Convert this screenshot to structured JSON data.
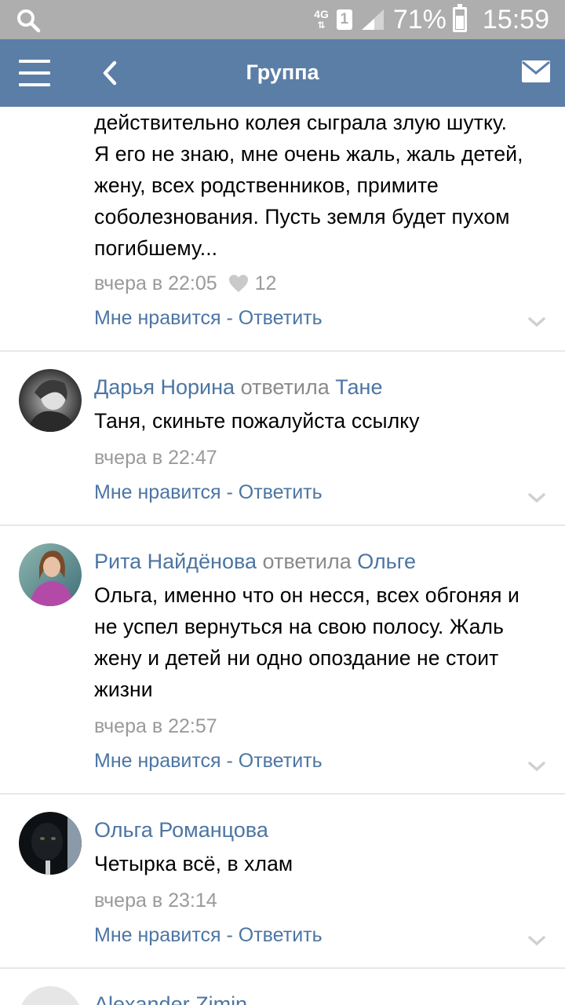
{
  "status_bar": {
    "network": "4G",
    "sim": "1",
    "battery_percent": "71%",
    "time": "15:59",
    "icons": [
      "search-icon",
      "signal-icon",
      "battery-icon"
    ]
  },
  "app_bar": {
    "title": "Группа",
    "icons": [
      "menu-icon",
      "back-icon",
      "mail-icon"
    ]
  },
  "comments": [
    {
      "text_lines": [
        "действительно колея сыграла злую шутку.",
        "Я его не знаю, мне очень жаль, жаль детей,",
        "жену, всех родственников, примите",
        "соболезнования. Пусть земля будет пухом",
        "погибшему..."
      ],
      "time": "вчера в 22:05",
      "likes": "12",
      "like_label": "Мне нравится",
      "separator": " - ",
      "reply_label": "Ответить"
    },
    {
      "author": "Дарья Норина",
      "replied_word": "ответила",
      "reply_to": "Тане",
      "text_lines": [
        "Таня, скиньте пожалуйста ссылку"
      ],
      "time": "вчера в 22:47",
      "like_label": "Мне нравится",
      "separator": " - ",
      "reply_label": "Ответить"
    },
    {
      "author": "Рита Найдёнова",
      "replied_word": "ответила",
      "reply_to": "Ольге",
      "text_lines": [
        "Ольга, именно что он несся, всех обгоняя и",
        "не успел вернуться на свою полосу. Жаль",
        "жену и детей ни одно опоздание не стоит",
        "жизни"
      ],
      "time": "вчера в 22:57",
      "like_label": "Мне нравится",
      "separator": " - ",
      "reply_label": "Ответить"
    },
    {
      "author": "Ольга Романцова",
      "text_lines": [
        "Четырка всё, в хлам"
      ],
      "time": "вчера в 23:14",
      "like_label": "Мне нравится",
      "separator": " - ",
      "reply_label": "Ответить"
    },
    {
      "author": "Alexander Zimin"
    }
  ],
  "colors": {
    "status_bar": "#aeaeae",
    "app_bar": "#5b7ea7",
    "link": "#4c75a3",
    "muted": "#9a9a9a",
    "divider": "#e7e8ec"
  }
}
